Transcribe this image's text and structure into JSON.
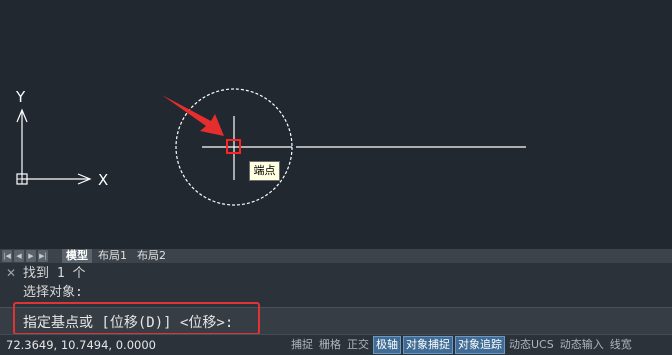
{
  "canvas": {
    "axis_y_label": "Y",
    "axis_x_label": "X",
    "osnap_tooltip": "端点"
  },
  "layout_tabs": {
    "nav_buttons": [
      "|◀",
      "◀",
      "▶",
      "▶|"
    ],
    "tabs": [
      {
        "label": "模型",
        "active": true
      },
      {
        "label": "布局1",
        "active": false
      },
      {
        "label": "布局2",
        "active": false
      }
    ]
  },
  "command": {
    "history": [
      "找到 1 个",
      "选择对象:"
    ],
    "prompt": "指定基点或 [位移(D)] <位移>:"
  },
  "status": {
    "coordinates": "72.3649, 10.7494, 0.0000",
    "toggles": [
      {
        "label": "捕捉",
        "on": false
      },
      {
        "label": "栅格",
        "on": false
      },
      {
        "label": "正交",
        "on": false
      },
      {
        "label": "极轴",
        "on": true
      },
      {
        "label": "对象捕捉",
        "on": true
      },
      {
        "label": "对象追踪",
        "on": true
      },
      {
        "label": "动态UCS",
        "on": false
      },
      {
        "label": "动态输入",
        "on": false
      },
      {
        "label": "线宽",
        "on": false
      }
    ]
  },
  "colors": {
    "canvas_bg": "#212830",
    "highlight_red": "#e03333",
    "toggle_on": "#3f6b95"
  }
}
